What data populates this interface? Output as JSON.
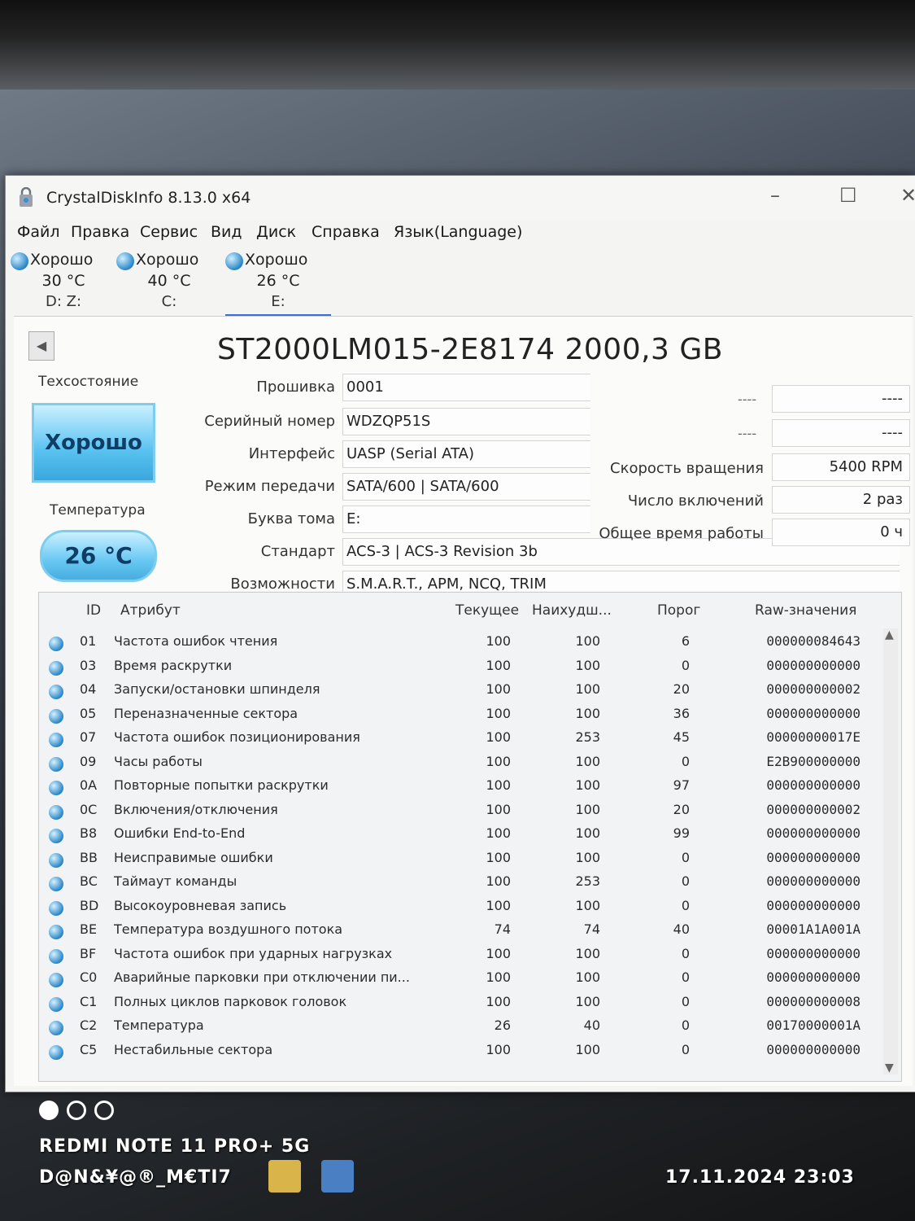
{
  "window": {
    "title": "CrystalDiskInfo 8.13.0 x64",
    "minimize": "–",
    "maximize": "☐",
    "close": "✕"
  },
  "menu": [
    "Файл",
    "Правка",
    "Сервис",
    "Вид",
    "Диск",
    "Справка",
    "Язык(Language)"
  ],
  "drives": [
    {
      "status": "Хорошо",
      "temp": "30 °C",
      "letter": "D: Z:"
    },
    {
      "status": "Хорошо",
      "temp": "40 °C",
      "letter": "C:"
    },
    {
      "status": "Хорошо",
      "temp": "26 °C",
      "letter": "E:"
    }
  ],
  "disk": {
    "model": "ST2000LM015-2E8174 2000,3 GB",
    "health_label": "Техсостояние",
    "health_value": "Хорошо",
    "temp_label": "Температура",
    "temp_value": "26 °C",
    "fields": [
      {
        "label": "Прошивка",
        "value": "0001"
      },
      {
        "label": "Серийный номер",
        "value": "WDZQP51S"
      },
      {
        "label": "Интерфейс",
        "value": "UASP (Serial ATA)"
      },
      {
        "label": "Режим передачи",
        "value": "SATA/600 | SATA/600"
      },
      {
        "label": "Буква тома",
        "value": "E:"
      },
      {
        "label": "Стандарт",
        "value": "ACS-3 | ACS-3 Revision 3b"
      },
      {
        "label": "Возможности",
        "value": "S.M.A.R.T., APM, NCQ, TRIM"
      }
    ],
    "right_top": [
      {
        "label": "----",
        "value": "----"
      },
      {
        "label": "----",
        "value": "----"
      }
    ],
    "right_fields": [
      {
        "label": "Скорость вращения",
        "value": "5400 RPM"
      },
      {
        "label": "Число включений",
        "value": "2 раз"
      },
      {
        "label": "Общее время работы",
        "value": "0 ч"
      }
    ]
  },
  "smart": {
    "headers": {
      "id": "ID",
      "attr": "Атрибут",
      "cur": "Текущее",
      "worst": "Наихудш...",
      "thr": "Порог",
      "raw": "Raw-значения"
    },
    "rows": [
      {
        "id": "01",
        "attr": "Частота ошибок чтения",
        "cur": "100",
        "worst": "100",
        "thr": "6",
        "raw": "000000084643"
      },
      {
        "id": "03",
        "attr": "Время раскрутки",
        "cur": "100",
        "worst": "100",
        "thr": "0",
        "raw": "000000000000"
      },
      {
        "id": "04",
        "attr": "Запуски/остановки шпинделя",
        "cur": "100",
        "worst": "100",
        "thr": "20",
        "raw": "000000000002"
      },
      {
        "id": "05",
        "attr": "Переназначенные сектора",
        "cur": "100",
        "worst": "100",
        "thr": "36",
        "raw": "000000000000"
      },
      {
        "id": "07",
        "attr": "Частота ошибок позиционирования",
        "cur": "100",
        "worst": "253",
        "thr": "45",
        "raw": "00000000017E"
      },
      {
        "id": "09",
        "attr": "Часы работы",
        "cur": "100",
        "worst": "100",
        "thr": "0",
        "raw": "E2B900000000"
      },
      {
        "id": "0A",
        "attr": "Повторные попытки раскрутки",
        "cur": "100",
        "worst": "100",
        "thr": "97",
        "raw": "000000000000"
      },
      {
        "id": "0C",
        "attr": "Включения/отключения",
        "cur": "100",
        "worst": "100",
        "thr": "20",
        "raw": "000000000002"
      },
      {
        "id": "B8",
        "attr": "Ошибки End-to-End",
        "cur": "100",
        "worst": "100",
        "thr": "99",
        "raw": "000000000000"
      },
      {
        "id": "BB",
        "attr": "Неисправимые ошибки",
        "cur": "100",
        "worst": "100",
        "thr": "0",
        "raw": "000000000000"
      },
      {
        "id": "BC",
        "attr": "Таймаут команды",
        "cur": "100",
        "worst": "253",
        "thr": "0",
        "raw": "000000000000"
      },
      {
        "id": "BD",
        "attr": "Высокоуровневая запись",
        "cur": "100",
        "worst": "100",
        "thr": "0",
        "raw": "000000000000"
      },
      {
        "id": "BE",
        "attr": "Температура воздушного потока",
        "cur": "74",
        "worst": "74",
        "thr": "40",
        "raw": "00001A1A001A"
      },
      {
        "id": "BF",
        "attr": "Частота ошибок при ударных нагрузках",
        "cur": "100",
        "worst": "100",
        "thr": "0",
        "raw": "000000000000"
      },
      {
        "id": "C0",
        "attr": "Аварийные парковки при отключении пи...",
        "cur": "100",
        "worst": "100",
        "thr": "0",
        "raw": "000000000000"
      },
      {
        "id": "C1",
        "attr": "Полных циклов парковок головок",
        "cur": "100",
        "worst": "100",
        "thr": "0",
        "raw": "000000000008"
      },
      {
        "id": "C2",
        "attr": "Температура",
        "cur": "26",
        "worst": "40",
        "thr": "0",
        "raw": "00170000001A"
      },
      {
        "id": "C5",
        "attr": "Нестабильные сектора",
        "cur": "100",
        "worst": "100",
        "thr": "0",
        "raw": "000000000000"
      }
    ]
  },
  "overlay": {
    "device": "REDMI NOTE 11 PRO+ 5G",
    "signature": "D@N&¥@®_M€TI7",
    "datetime": "17.11.2024  23:03"
  }
}
